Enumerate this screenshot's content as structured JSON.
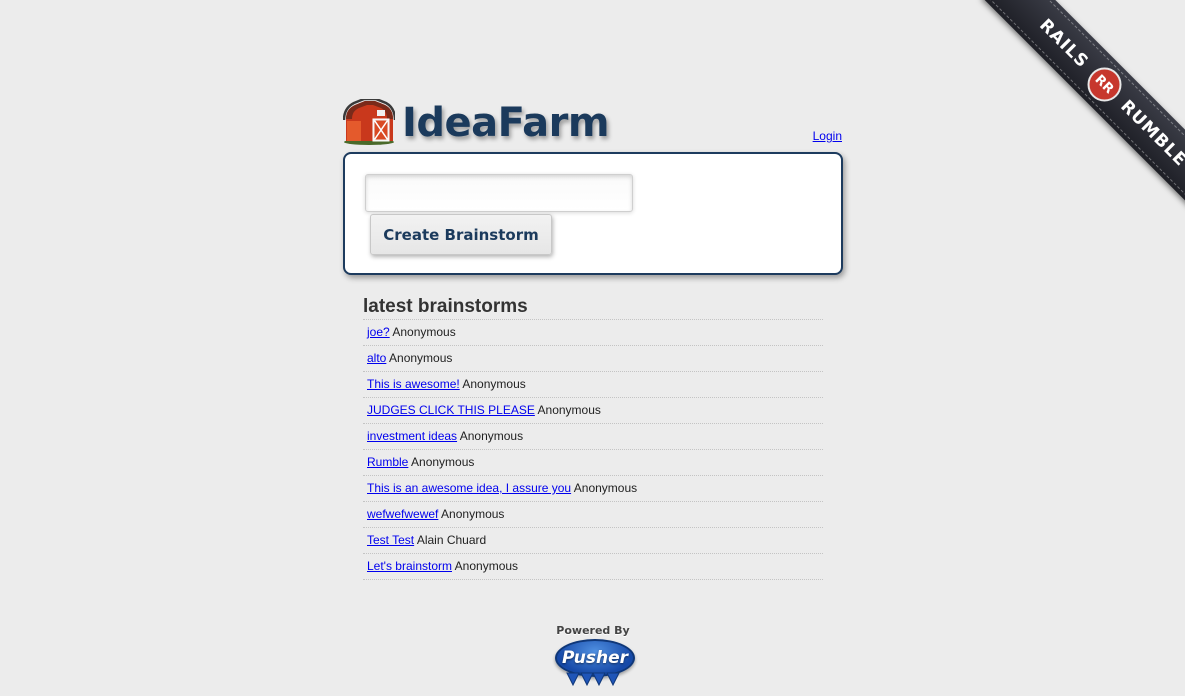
{
  "ribbon": {
    "left_text": "RAILS",
    "logo_text": "RR",
    "right_text": "RUMBLE"
  },
  "header": {
    "logo_text": "IdeaFarm",
    "login_label": "Login",
    "logo_icon": "barn-icon"
  },
  "create": {
    "input_value": "",
    "input_placeholder": "",
    "button_label": "Create Brainstorm"
  },
  "latest": {
    "title": "latest brainstorms",
    "items": [
      {
        "title": "joe?",
        "author": "Anonymous"
      },
      {
        "title": "alto",
        "author": "Anonymous"
      },
      {
        "title": "This is awesome!",
        "author": "Anonymous"
      },
      {
        "title": "JUDGES CLICK THIS PLEASE",
        "author": "Anonymous"
      },
      {
        "title": "investment ideas",
        "author": "Anonymous"
      },
      {
        "title": "Rumble",
        "author": "Anonymous"
      },
      {
        "title": "This is an awesome idea, I assure you",
        "author": "Anonymous"
      },
      {
        "title": "wefwefwewef",
        "author": "Anonymous"
      },
      {
        "title": "Test Test",
        "author": "Alain Chuard"
      },
      {
        "title": "Let's brainstorm",
        "author": "Anonymous"
      }
    ]
  },
  "footer": {
    "powered_label": "Powered By",
    "pusher_label": "Pusher"
  },
  "colors": {
    "background": "#ececec",
    "brand_navy": "#1b3a5c",
    "link_blue": "#0000ee",
    "barn_red": "#d84b28",
    "pusher_blue": "#1649a8"
  }
}
